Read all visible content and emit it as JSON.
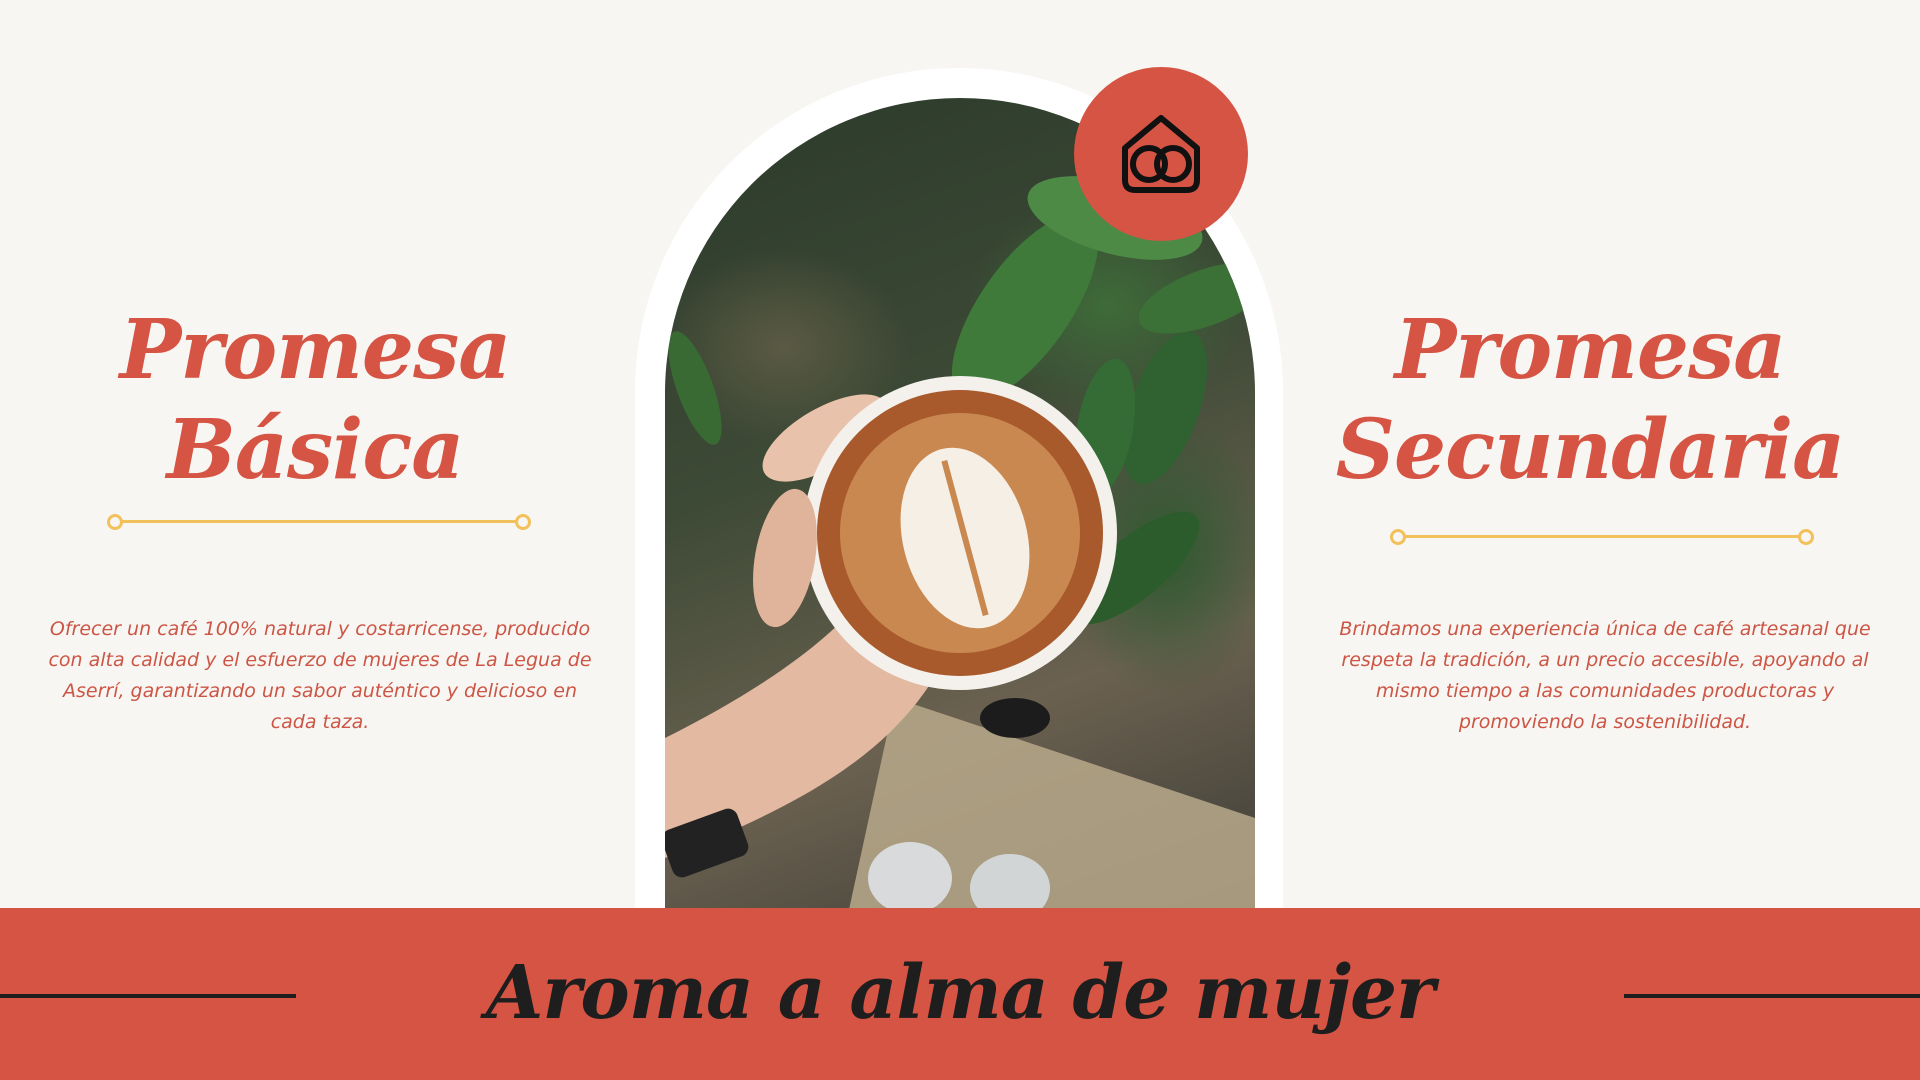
{
  "left": {
    "title_line1": "Promesa",
    "title_line2": "Básica",
    "body": "Ofrecer un café 100% natural y costarricense, producido con alta calidad y el esfuerzo de mujeres de La Legua de Aserrí, garantizando un sabor auténtico y delicioso en cada taza."
  },
  "right": {
    "title_line1": "Promesa",
    "title_line2": "Secundaria",
    "body": "Brindamos una experiencia única de café artesanal que respeta la tradición, a un precio accesible, apoyando al mismo tiempo a las comunidades productoras y promoviendo la sostenibilidad."
  },
  "banner": {
    "tagline": "Aroma a alma de mujer"
  },
  "icons": {
    "logo": "house-coffee-bean-icon"
  },
  "colors": {
    "accent": "#d65443",
    "divider": "#f2c15c",
    "background": "#f8f6f2",
    "text_dark": "#1e1e1e"
  }
}
